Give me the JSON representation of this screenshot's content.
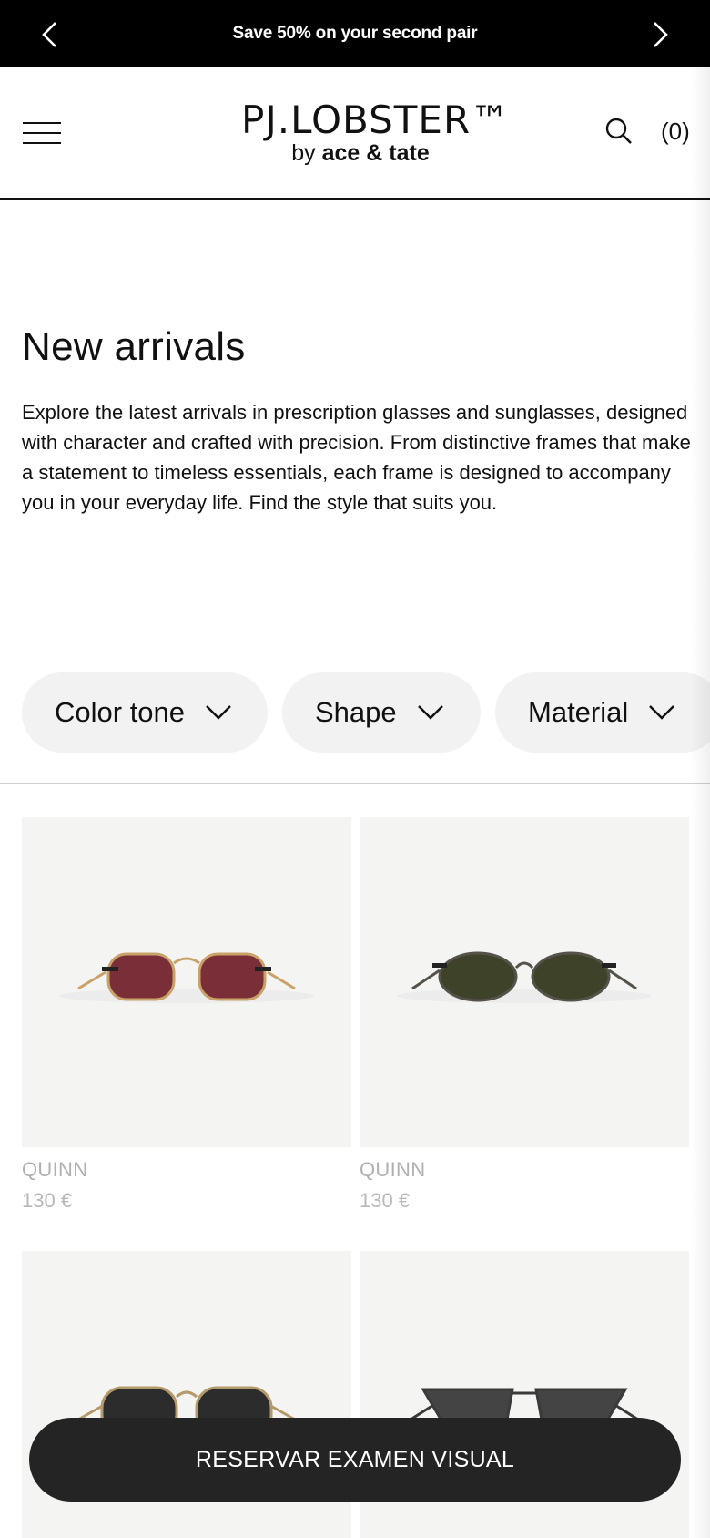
{
  "promo": {
    "text": "Save 50% on your second pair"
  },
  "header": {
    "logo_main": "PJ.LOBSTER™",
    "logo_by": "by",
    "logo_brand": "ace & tate",
    "cart_label": "(0)"
  },
  "intro": {
    "title": "New arrivals",
    "description": "Explore the latest arrivals in prescription glasses and sunglasses, designed with character and crafted with precision. From distinctive frames that make a statement to timeless essentials, each frame is designed to accompany you in your everyday life. Find the style that suits you."
  },
  "filters": [
    {
      "label": "Color tone"
    },
    {
      "label": "Shape"
    },
    {
      "label": "Material"
    }
  ],
  "products": [
    {
      "name": "QUINN",
      "price": "130 €",
      "frame_color": "#c9a26a",
      "lens_color": "#7a2f38"
    },
    {
      "name": "QUINN",
      "price": "130 €",
      "frame_color": "#55524a",
      "lens_color": "#3e4228"
    },
    {
      "name": "",
      "price": "",
      "frame_color": "#b49a6b",
      "lens_color": "#2c2c2c"
    },
    {
      "name": "",
      "price": "",
      "frame_color": "#3a3a3a",
      "lens_color": "#444444"
    }
  ],
  "cta": {
    "label": "RESERVAR EXAMEN VISUAL"
  },
  "colors": {
    "promo_bg": "#000000",
    "chip_bg": "#f2f2f2",
    "cta_bg": "#242424",
    "product_bg": "#f4f4f3"
  }
}
